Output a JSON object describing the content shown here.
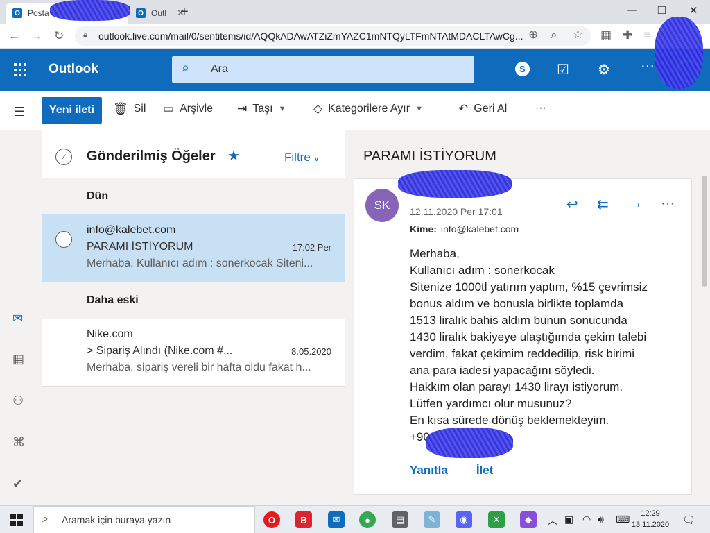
{
  "browser": {
    "tabs": [
      {
        "label": "Posta"
      },
      {
        "label": "Outl"
      }
    ],
    "new_tab": "+",
    "url": "outlook.live.com/mail/0/sentitems/id/AQQkADAwATZiZmYAZC1mNTQyLTFmNTAtMDACLTAwCg...",
    "window_controls": {
      "minimize": "—",
      "restore": "❐",
      "close": "✕"
    }
  },
  "header": {
    "brand": "Outlook",
    "search_placeholder": "Ara",
    "skype_label": "S",
    "more": "···"
  },
  "toolbar": {
    "new_mail": "Yeni ileti",
    "delete": "Sil",
    "archive": "Arşivle",
    "move": "Taşı",
    "categorize": "Kategorilere Ayır",
    "undo": "Geri Al",
    "more": "···"
  },
  "list": {
    "folder_title": "Gönderilmiş Öğeler",
    "filter": "Filtre",
    "groups": [
      {
        "label": "Dün",
        "messages": [
          {
            "from": "info@kalebet.com",
            "subject": "PARAMI İSTİYORUM",
            "time": "17:02 Per",
            "preview": "Merhaba, Kullanıcı adım : sonerkocak Siteni..."
          }
        ]
      },
      {
        "label": "Daha eski",
        "messages": [
          {
            "from": "Nike.com",
            "subject": "> Sipariş Alındı (Nike.com #...",
            "time": "8.05.2020",
            "preview": "Merhaba, sipariş vereli bir hafta oldu fakat h..."
          }
        ]
      }
    ]
  },
  "reading": {
    "subject": "PARAMI İSTİYORUM",
    "sender_initials": "SK",
    "date": "12.11.2020 Per 17:01",
    "to_label": "Kime:",
    "to_value": "info@kalebet.com",
    "body_lines": [
      "Merhaba,",
      "Kullanıcı adım : sonerkocak",
      "Sitenize 1000tl yatırım yaptım, %15 çevrimsiz",
      "bonus aldım ve bonusla birlikte toplamda",
      "1513 liralık bahis aldım bunun sonucunda",
      "1430 liralık bakiyeye ulaştığımda çekim talebi",
      "verdim, fakat çekimim reddedilip, risk birimi",
      "ana para iadesi yapacağını söyledi.",
      "Hakkım olan parayı 1430 lirayı istiyorum.",
      "Lütfen yardımcı olur musunuz?",
      "En kısa sürede dönüş beklemekteyim.",
      "+90"
    ],
    "reply": "Yanıtla",
    "forward": "İlet"
  },
  "taskbar": {
    "search_placeholder": "Aramak için buraya yazın",
    "time": "12:29",
    "date": "13.11.2020"
  },
  "colors": {
    "accent": "#0f6cbd",
    "selected_row": "#c7e0f4",
    "avatar": "#8764b8",
    "redaction": "#2b2bd9"
  }
}
